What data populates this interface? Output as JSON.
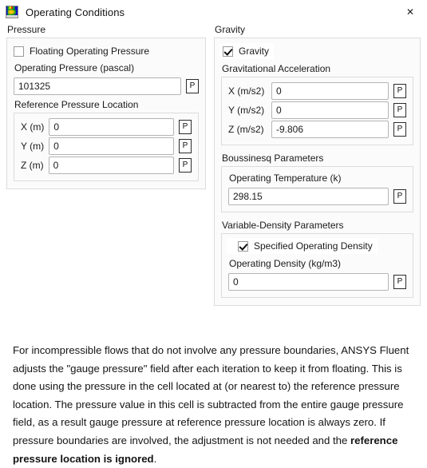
{
  "window": {
    "title": "Operating Conditions",
    "icon": "fluent-app-icon",
    "close_label": "✕"
  },
  "pressure": {
    "group_label": "Pressure",
    "floating_operating_pressure": {
      "label": "Floating Operating Pressure",
      "checked": false
    },
    "operating_pressure": {
      "label": "Operating Pressure (pascal)",
      "value": "101325",
      "param_button": "P"
    },
    "reference_pressure_location": {
      "label": "Reference Pressure Location",
      "fields": [
        {
          "label": "X (m)",
          "value": "0",
          "param_button": "P"
        },
        {
          "label": "Y (m)",
          "value": "0",
          "param_button": "P"
        },
        {
          "label": "Z (m)",
          "value": "0",
          "param_button": "P"
        }
      ]
    }
  },
  "gravity": {
    "group_label": "Gravity",
    "gravity_toggle": {
      "label": "Gravity",
      "checked": true
    },
    "gravitational_acceleration": {
      "label": "Gravitational Acceleration",
      "fields": [
        {
          "label": "X (m/s2)",
          "value": "0",
          "param_button": "P"
        },
        {
          "label": "Y (m/s2)",
          "value": "0",
          "param_button": "P"
        },
        {
          "label": "Z (m/s2)",
          "value": "-9.806",
          "param_button": "P"
        }
      ]
    },
    "boussinesq": {
      "group_label": "Boussinesq Parameters",
      "operating_temperature": {
        "label": "Operating Temperature (k)",
        "value": "298.15",
        "param_button": "P"
      }
    },
    "variable_density": {
      "group_label": "Variable-Density Parameters",
      "specified_operating_density": {
        "label": "Specified Operating Density",
        "checked": true
      },
      "operating_density": {
        "label": "Operating Density (kg/m3)",
        "value": "0",
        "param_button": "P"
      }
    }
  },
  "description": {
    "part1": "For incompressible flows that do not involve any pressure boundaries, ANSYS Fluent adjusts the \"gauge pressure\" field after each iteration to keep it from floating. This is done using the pressure in the cell located at (or nearest to) the reference pressure location. The pressure value in this cell is subtracted from the entire gauge pressure field, as a result gauge pressure at reference pressure location is always zero. If pressure boundaries are involved, the adjustment is not needed and the ",
    "bold": "reference pressure location is ignored",
    "part2": "."
  }
}
